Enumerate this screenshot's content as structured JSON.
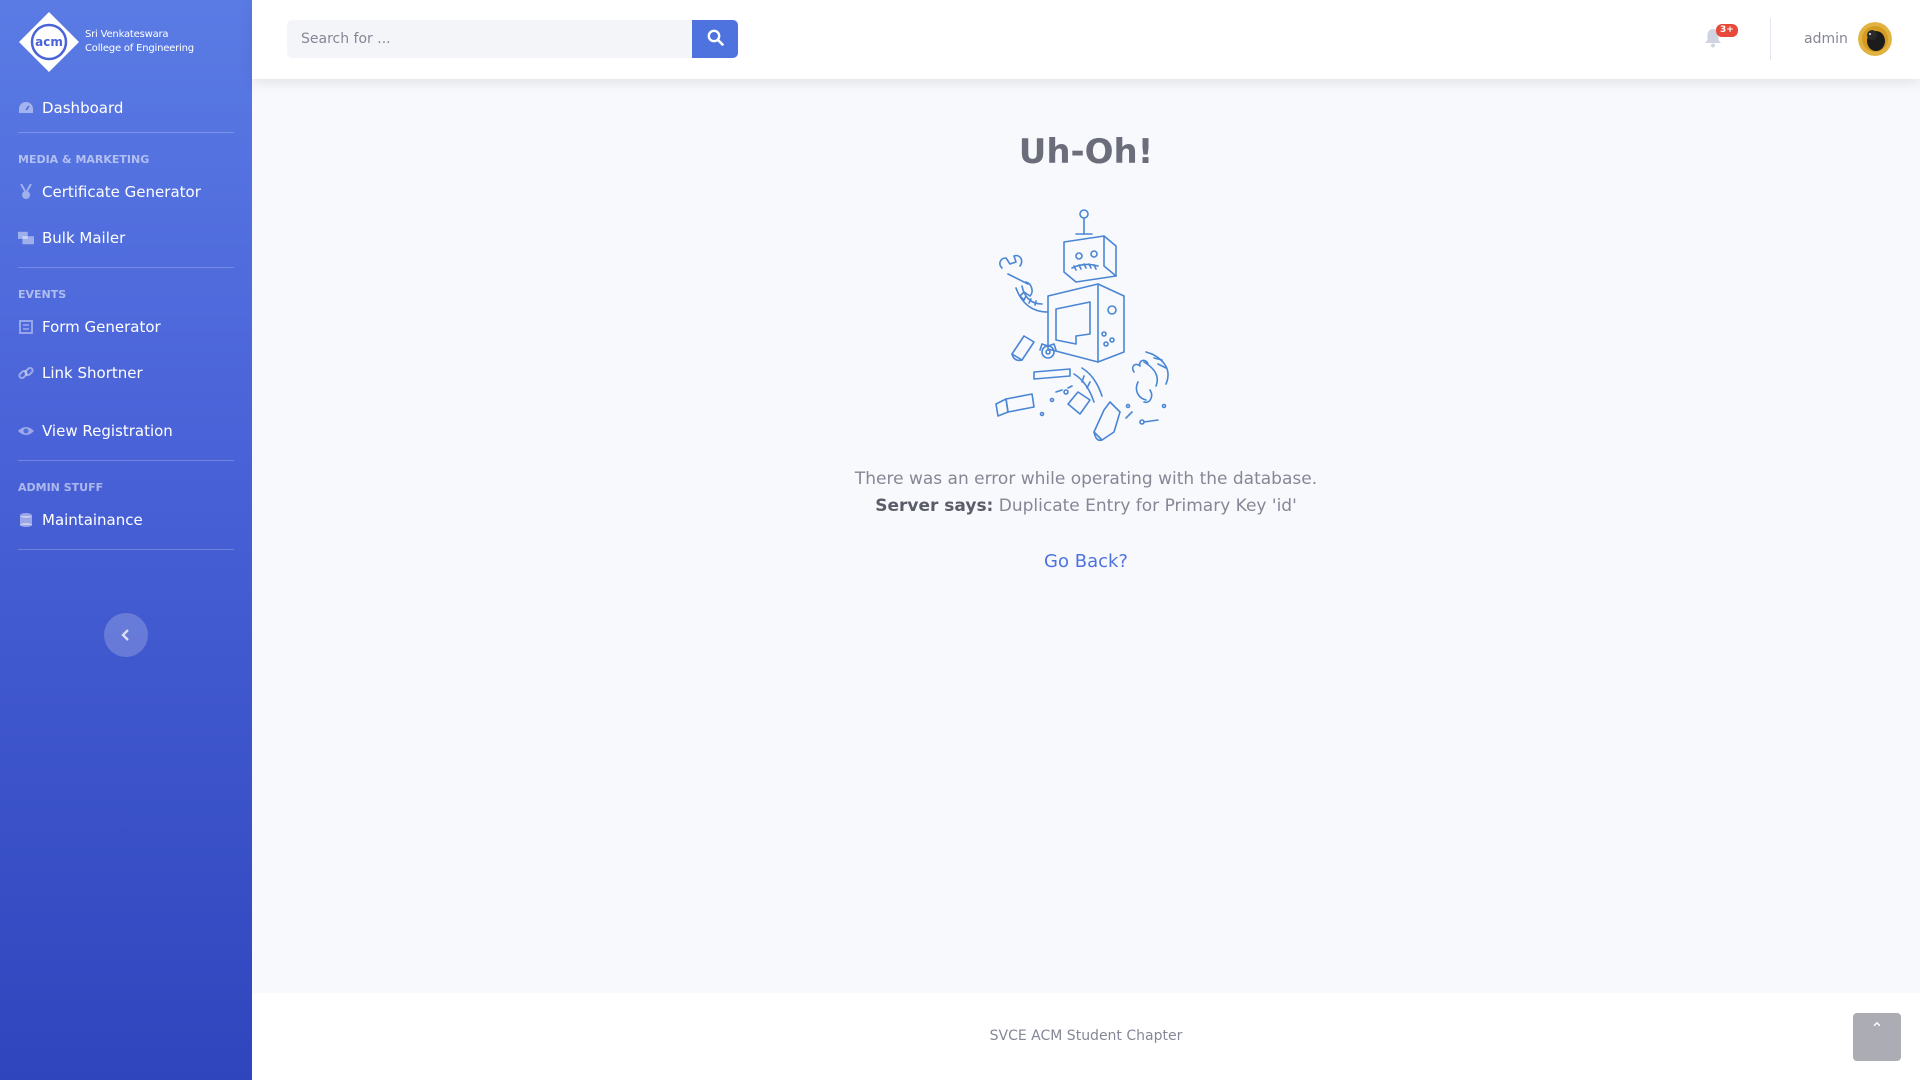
{
  "brand": {
    "logo_text": "acm",
    "line1": "Sri Venkateswara",
    "line2": "College of Engineering"
  },
  "sidebar": {
    "dashboard": {
      "label": "Dashboard",
      "icon": "tachometer-icon"
    },
    "sections": [
      {
        "heading": "MEDIA & MARKETING",
        "items": [
          {
            "label": "Certificate Generator",
            "icon": "medal-icon"
          },
          {
            "label": "Bulk Mailer",
            "icon": "mail-bulk-icon"
          }
        ]
      },
      {
        "heading": "EVENTS",
        "items": [
          {
            "label": "Form Generator",
            "icon": "form-icon"
          },
          {
            "label": "Link Shortner",
            "icon": "link-icon"
          },
          {
            "label": "View Registration",
            "icon": "eye-icon"
          }
        ]
      },
      {
        "heading": "ADMIN STUFF",
        "items": [
          {
            "label": "Maintainance",
            "icon": "database-icon"
          }
        ]
      }
    ],
    "toggle_icon": "chevron-left-icon"
  },
  "topbar": {
    "search_placeholder": "Search for ...",
    "notification_badge": "3+",
    "user_name": "admin"
  },
  "main": {
    "title": "Uh-Oh!",
    "message": "There was an error while operating with the database.",
    "server_label": "Server says:",
    "server_message": "Duplicate Entry for Primary Key 'id'",
    "go_back": "Go Back?"
  },
  "footer": {
    "text": "SVCE ACM Student Chapter"
  },
  "colors": {
    "primary": "#4e73df",
    "danger": "#e74a3b",
    "sidebar_top": "#5a7be4",
    "sidebar_bottom": "#2f45bd"
  }
}
